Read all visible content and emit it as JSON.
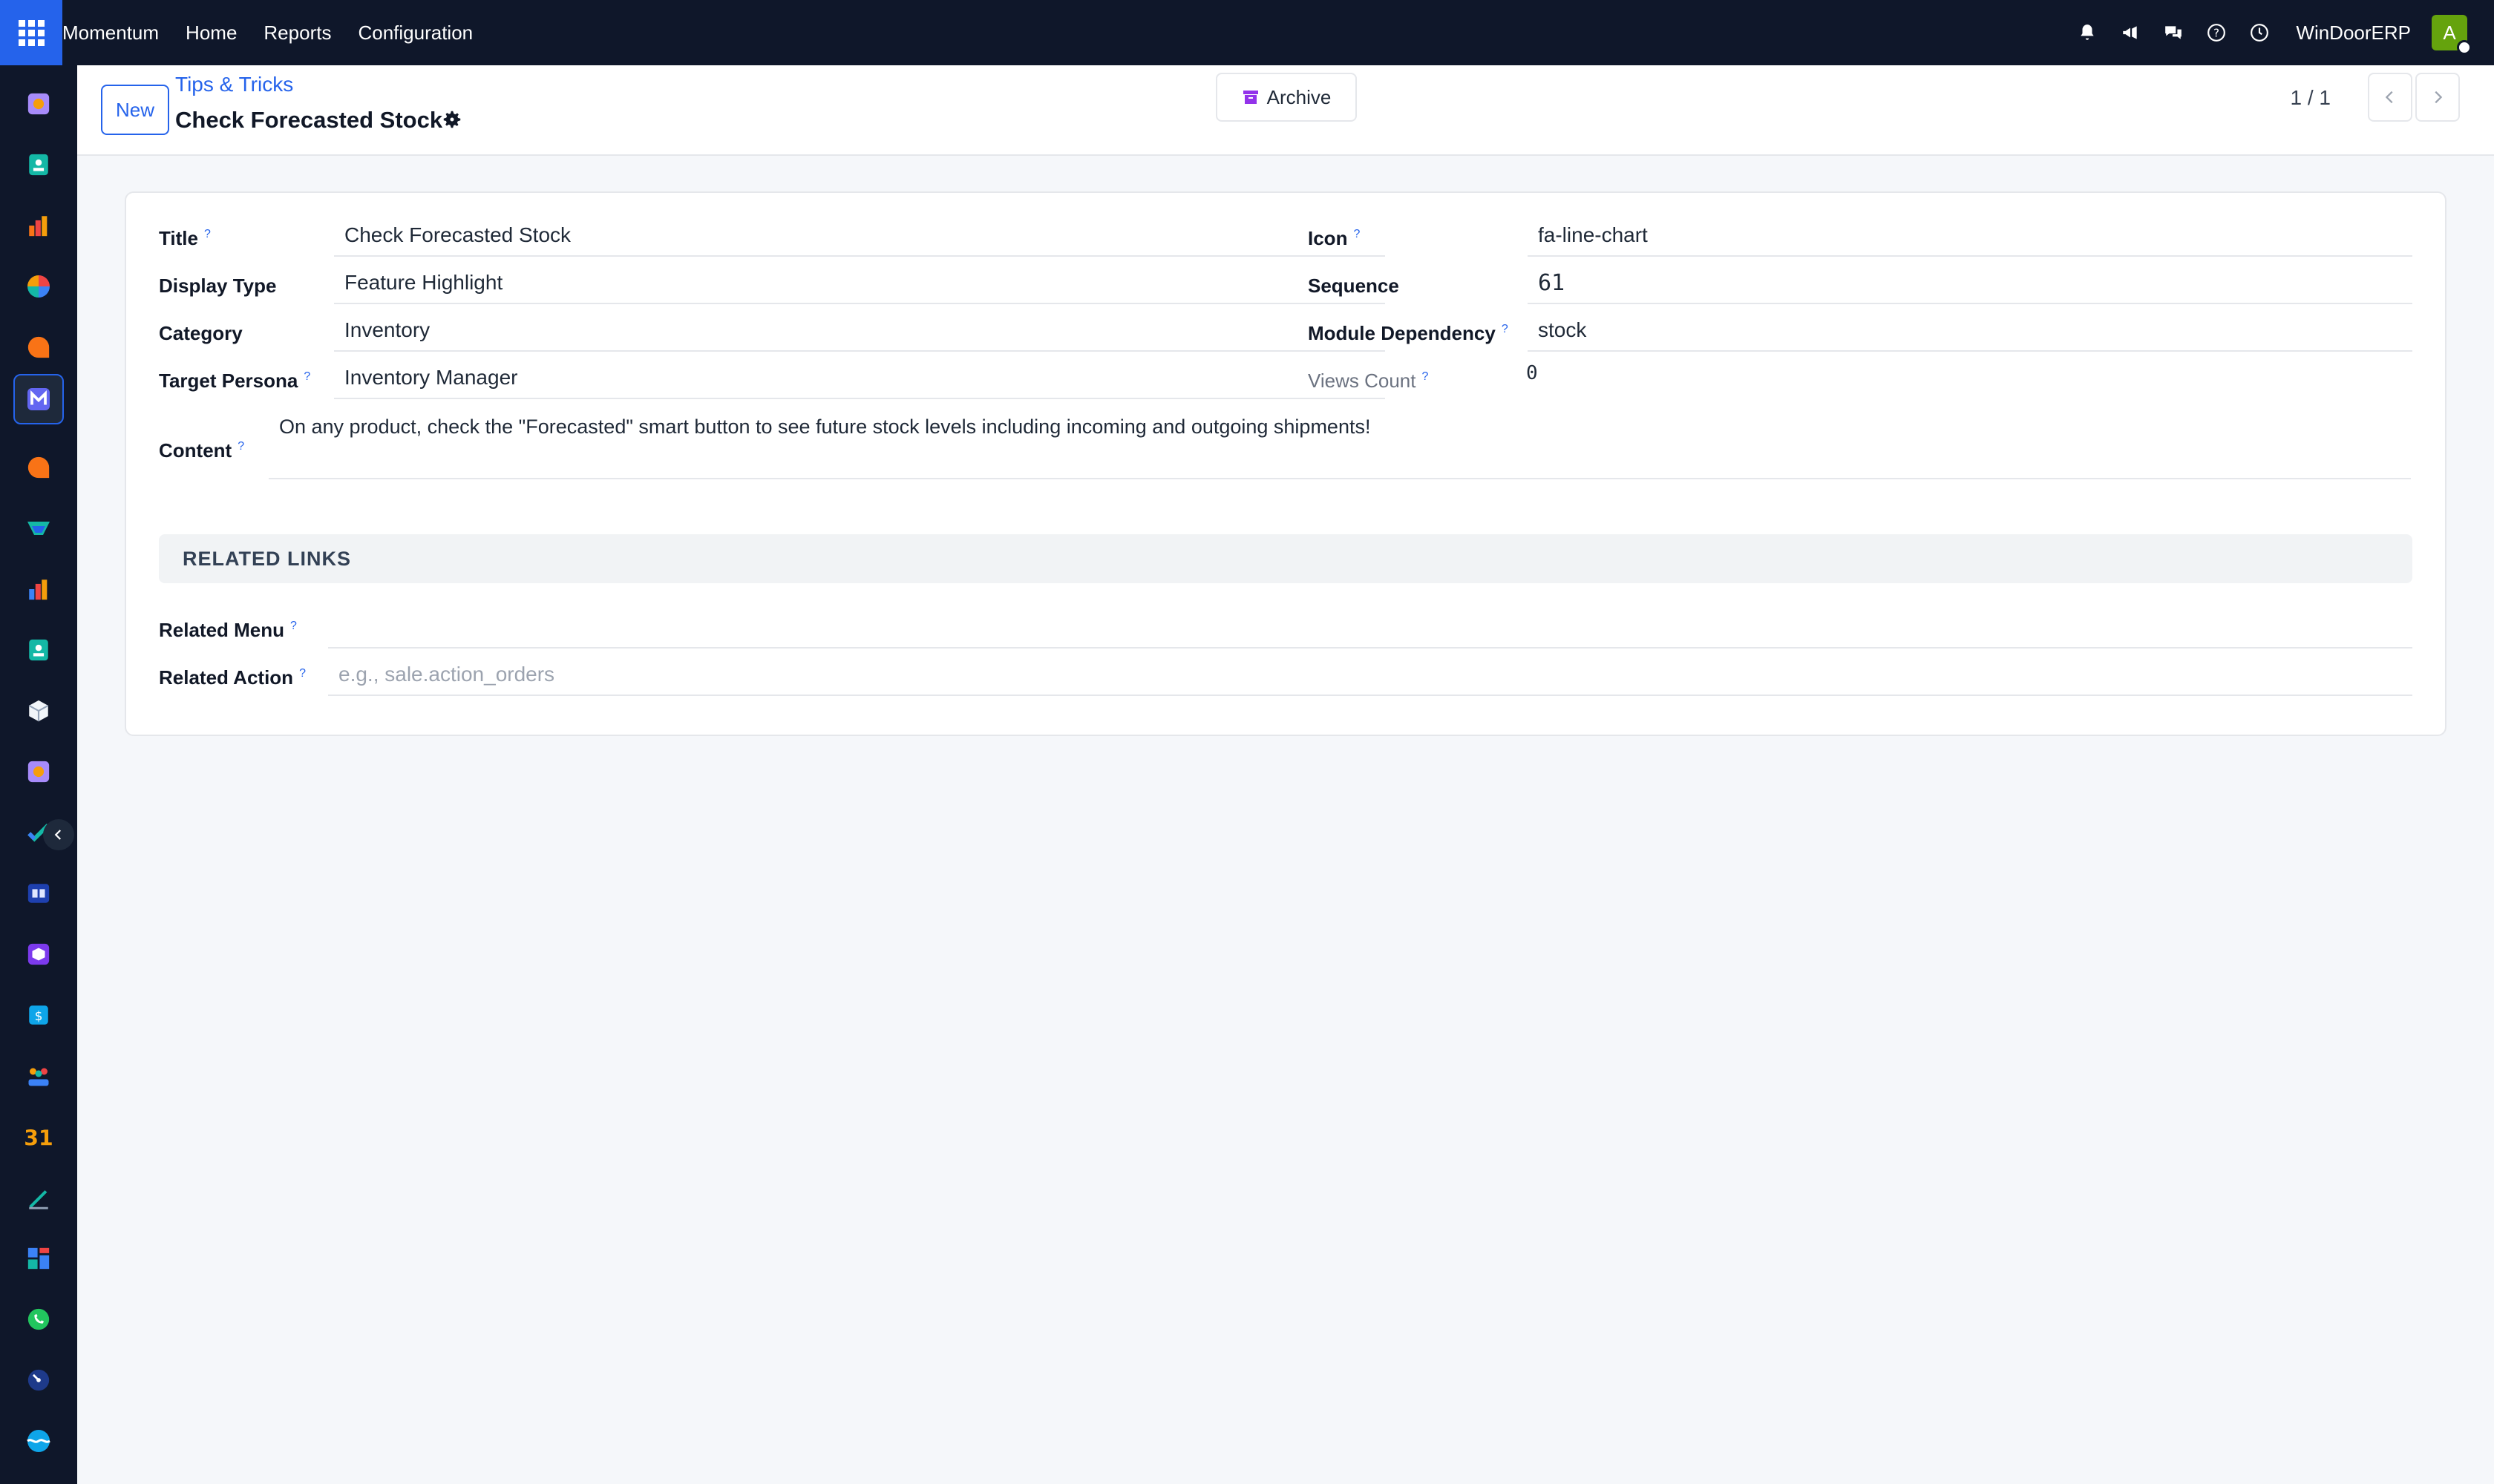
{
  "topbar": {
    "brand": "Momentum",
    "menu": [
      "Home",
      "Reports",
      "Configuration"
    ],
    "company": "WinDoorERP",
    "avatar_letter": "A",
    "icons": [
      "bell-icon",
      "megaphone-icon",
      "chat-icon",
      "help-icon",
      "clock-icon"
    ]
  },
  "sidebar": {
    "apps": [
      "app-1",
      "app-2",
      "app-3",
      "app-4",
      "app-5",
      "app-6",
      "app-7",
      "app-8",
      "app-9",
      "app-10",
      "app-11",
      "app-12",
      "app-13",
      "app-14",
      "app-15",
      "app-16",
      "app-17",
      "app-18",
      "app-19",
      "app-20",
      "app-21",
      "app-22",
      "app-23"
    ]
  },
  "controlbar": {
    "new_label": "New",
    "breadcrumb": "Tips & Tricks",
    "record_title": "Check Forecasted Stock",
    "archive_label": "Archive",
    "pager": "1 / 1"
  },
  "form": {
    "title_label": "Title",
    "title_value": "Check Forecasted Stock",
    "display_type_label": "Display Type",
    "display_type_value": "Feature Highlight",
    "category_label": "Category",
    "category_value": "Inventory",
    "persona_label": "Target Persona",
    "persona_value": "Inventory Manager",
    "icon_label": "Icon",
    "icon_value": "fa-line-chart",
    "sequence_label": "Sequence",
    "sequence_value": "61",
    "module_label": "Module Dependency",
    "module_value": "stock",
    "views_label": "Views Count",
    "views_value": "0",
    "content_label": "Content",
    "content_value": "On any product, check the \"Forecasted\" smart button to see future stock levels including incoming and outgoing shipments!",
    "section_title": "RELATED LINKS",
    "related_menu_label": "Related Menu",
    "related_menu_value": "",
    "related_action_label": "Related Action",
    "related_action_placeholder": "e.g., sale.action_orders",
    "help_marker": "?"
  },
  "colors": {
    "topbar": "#0f172a",
    "accent": "#2563eb",
    "avatar": "#65a30d",
    "archive_icon": "#9333ea"
  }
}
